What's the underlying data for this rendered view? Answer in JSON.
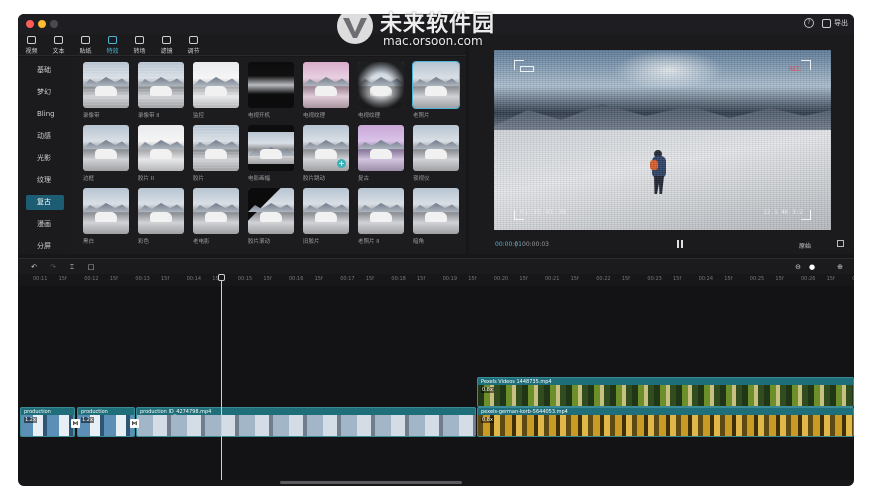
{
  "watermark": {
    "cn": "未来软件园",
    "en": "mac.orsoon.com"
  },
  "titlebar": {
    "help_icon": "question-circle-icon",
    "export_label": "导出"
  },
  "toolbar": [
    {
      "label": "视频",
      "icon": "video-icon",
      "active": false
    },
    {
      "label": "文本",
      "icon": "text-icon",
      "active": false
    },
    {
      "label": "贴纸",
      "icon": "sticker-icon",
      "active": false
    },
    {
      "label": "特效",
      "icon": "effects-icon",
      "active": true
    },
    {
      "label": "转场",
      "icon": "transition-icon",
      "active": false
    },
    {
      "label": "滤镜",
      "icon": "filter-icon",
      "active": false
    },
    {
      "label": "调节",
      "icon": "adjust-icon",
      "active": false
    }
  ],
  "categories": [
    "基础",
    "梦幻",
    "Bling",
    "动感",
    "光影",
    "纹理",
    "复古",
    "漫画",
    "分屏"
  ],
  "active_category": "复古",
  "effects": [
    {
      "label": "录像带"
    },
    {
      "label": "录像带 II"
    },
    {
      "label": "监控"
    },
    {
      "label": "电视开机"
    },
    {
      "label": "电视纹理"
    },
    {
      "label": "电视纹理"
    },
    {
      "label": "老照片"
    },
    {
      "label": "边框"
    },
    {
      "label": "胶片 II"
    },
    {
      "label": "胶片"
    },
    {
      "label": "电影画幅"
    },
    {
      "label": "胶片跳动"
    },
    {
      "label": "复古"
    },
    {
      "label": "夜视仪"
    },
    {
      "label": "黑白"
    },
    {
      "label": "彩色"
    },
    {
      "label": "老电影"
    },
    {
      "label": "胶片滚动"
    },
    {
      "label": "旧胶片"
    },
    {
      "label": "老照片 II"
    },
    {
      "label": "暗角"
    }
  ],
  "preview": {
    "rec_label": "REC",
    "timecode": "01:35:01:38",
    "resolution": "12.1 4K 3:2",
    "current_time": "00:00:01",
    "separator": "|",
    "duration": "00:00:03",
    "ratio_label": "原始"
  },
  "timeline": {
    "ruler_ticks": [
      "00:11",
      "15f",
      "00:12",
      "15f",
      "00:13",
      "15f",
      "00:14",
      "15f",
      "00:15",
      "15f",
      "00:16",
      "15f",
      "00:17",
      "15f",
      "00:18",
      "15f",
      "00:19",
      "15f",
      "00:20",
      "15f",
      "00:21",
      "15f",
      "00:22",
      "15f",
      "00:23",
      "15f",
      "00:24",
      "15f",
      "00:25",
      "15f",
      "00:26",
      "15f",
      "00:27",
      "15f",
      "00:28",
      "15f"
    ],
    "clips": [
      {
        "name": "Pexels Videos 1448735.mp4",
        "speed": "0.8x"
      },
      {
        "name": "production",
        "speed": "1.2x"
      },
      {
        "name": "production",
        "speed": "1.2x"
      },
      {
        "name": "production ID_4274798.mp4",
        "speed": ""
      },
      {
        "name": "pexels-german-korb-5644053.mp4",
        "speed": "0.8x"
      }
    ]
  }
}
